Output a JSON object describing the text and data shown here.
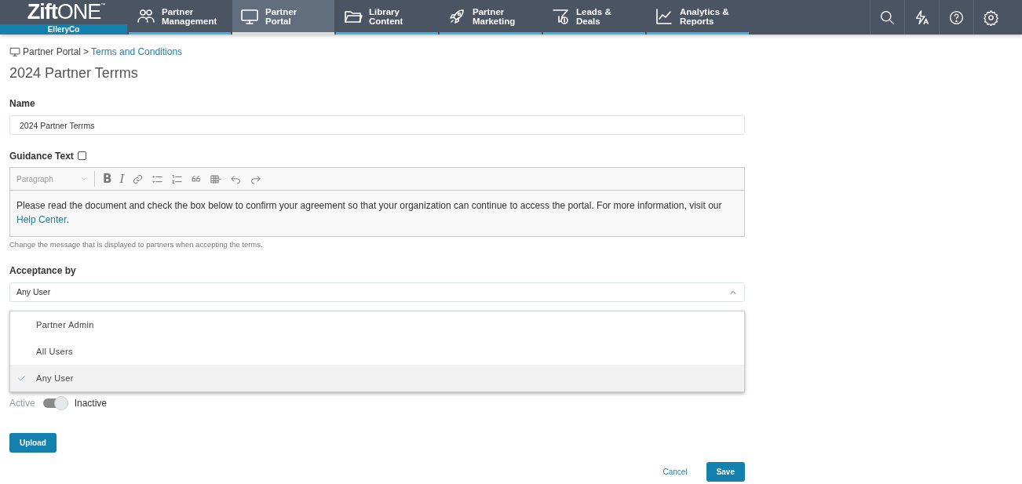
{
  "header": {
    "logo": "**Zift**ONE$^{™}$",
    "org": "ElleryCo",
    "tabs": [
      {
        "label": "Partner Management",
        "selected": false
      },
      {
        "label": "Partner Portal",
        "selected": true
      },
      {
        "label": "Library Content",
        "selected": false
      },
      {
        "label": "Partner Marketing",
        "selected": false
      },
      {
        "label": "Leads & Deals",
        "selected": false
      },
      {
        "label": "Analytics & Reports",
        "selected": false
      }
    ]
  },
  "breadcrumb": {
    "section": "Partner Portal",
    "separator": ">",
    "current": "Terms and Conditions"
  },
  "title": "2024 Partner Terrms",
  "name_field": {
    "label": "Name",
    "value": "2024 Partner Terrms"
  },
  "guidance": {
    "label": "Guidance Text",
    "checked": false,
    "toolbar": [
      {
        "kind": "style",
        "label": "Paragraph"
      },
      {
        "kind": "bold",
        "label": "B"
      },
      {
        "kind": "italic",
        "label": "I"
      },
      {
        "kind": "link"
      },
      {
        "kind": "bullets"
      },
      {
        "kind": "numbers"
      },
      {
        "kind": "quote"
      },
      {
        "kind": "table"
      },
      {
        "kind": "undo"
      },
      {
        "kind": "redo"
      }
    ],
    "text": "Please read the document and check the box below to confirm your agreement so that your organization can continue to access the portal. For more information, visit our",
    "link": "Help Center",
    "after_link": ".",
    "help": "Change the message that is displayed to partners when accepting the terms."
  },
  "acceptance": {
    "label": "Acceptance by",
    "value": "Any User",
    "expanded": true,
    "options": [
      {
        "label": "Partner Admin",
        "selected": false
      },
      {
        "label": "All Users",
        "selected": false
      },
      {
        "label": "Any User",
        "selected": true
      }
    ]
  },
  "status": {
    "on_label": "Active",
    "off_label": "Inactive",
    "on": false
  },
  "upload": "Upload",
  "cancel": "Cancel",
  "save": "Save"
}
